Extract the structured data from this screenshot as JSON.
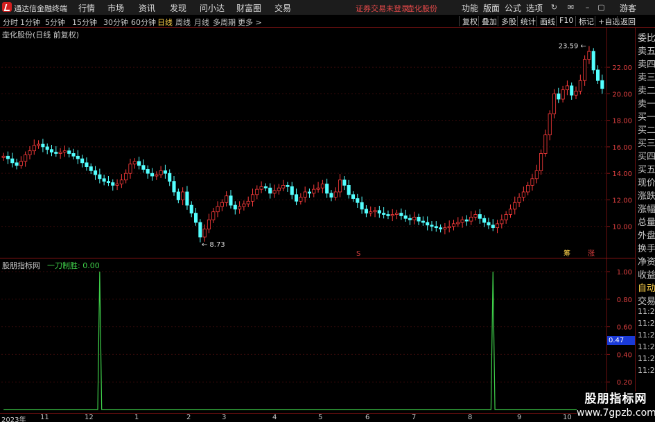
{
  "app": {
    "title": "通达信金融终端",
    "login_status": "证券交易未登录",
    "stock_name": "壶化股份"
  },
  "menu": [
    "行情",
    "市场",
    "资讯",
    "发现",
    "问小达",
    "财富圈",
    "交易"
  ],
  "right_menu": [
    "功能",
    "版面",
    "公式",
    "选项",
    "游客"
  ],
  "periods": [
    "分时",
    "1分钟",
    "5分钟",
    "15分钟",
    "30分钟",
    "60分钟",
    "日线",
    "周线",
    "月线",
    "多周期",
    "更多 >"
  ],
  "active_period": "日线",
  "toolbar_buttons": [
    "复权",
    "叠加",
    "多股",
    "统计",
    "画线",
    "F10",
    "标记",
    "+自选",
    "返回"
  ],
  "main_chart": {
    "title": "壶化股份(日线 前复权)",
    "y_ticks": [
      "22.00",
      "20.00",
      "18.00",
      "16.00",
      "14.00",
      "12.00",
      "10.00"
    ],
    "high_label": "23.59",
    "low_label": "8.73",
    "markers": [
      "S",
      "筹",
      "涨"
    ]
  },
  "indicator": {
    "title": "股朋指标网",
    "subtitle": "一刀制胜: 0.00",
    "y_ticks": [
      "1.00",
      "0.80",
      "0.60",
      "0.40",
      "0.20"
    ],
    "cursor_value": "0.47"
  },
  "right_panel": [
    "委比",
    "卖五",
    "卖四",
    "卖三",
    "卖二",
    "卖一",
    "买一",
    "买二",
    "买三",
    "买四",
    "买五",
    "现价",
    "涨跌",
    "涨幅",
    "总量",
    "外盘",
    "换手",
    "净资",
    "收益"
  ],
  "right_panel2": [
    "自动",
    "交易",
    "11:2",
    "11:2",
    "11:2",
    "11:2",
    "11:2",
    "11:2",
    "11:2",
    "11:2",
    "11:2",
    "11:2"
  ],
  "date_axis": [
    "2023年",
    "11",
    "12",
    "1",
    "2",
    "3",
    "4",
    "5",
    "6",
    "7",
    "8",
    "9",
    "10"
  ],
  "watermark": {
    "line1": "股朋指标网",
    "line2": "www.7gpzb.com"
  },
  "colors": {
    "up": "#ff3c3c",
    "down": "#54ffff",
    "indicator": "#3fd04a",
    "axis": "#6b1010"
  },
  "chart_data": {
    "type": "candlestick",
    "close": [
      15.3,
      15.1,
      14.8,
      14.6,
      14.9,
      15.4,
      15.7,
      16.1,
      16.2,
      16.0,
      15.8,
      15.6,
      15.5,
      15.6,
      15.7,
      15.5,
      15.3,
      15.1,
      14.8,
      14.5,
      14.2,
      13.9,
      13.6,
      13.4,
      13.3,
      13.1,
      13.2,
      13.5,
      14.0,
      14.7,
      14.9,
      14.6,
      14.3,
      14.0,
      13.8,
      13.9,
      14.2,
      14.0,
      13.4,
      12.6,
      12.0,
      12.6,
      11.6,
      11.0,
      10.3,
      9.2,
      9.8,
      10.5,
      11.1,
      11.5,
      11.8,
      12.3,
      11.6,
      11.3,
      11.5,
      11.7,
      11.9,
      12.4,
      12.8,
      13.0,
      12.9,
      12.5,
      12.7,
      12.9,
      13.1,
      13.0,
      12.4,
      11.9,
      12.2,
      12.6,
      12.5,
      12.8,
      12.9,
      13.2,
      12.5,
      12.2,
      12.6,
      13.5,
      13.1,
      12.4,
      12.1,
      11.8,
      11.3,
      11.0,
      11.1,
      11.2,
      11.0,
      10.9,
      10.8,
      10.9,
      11.0,
      10.8,
      10.6,
      10.5,
      10.7,
      10.4,
      10.3,
      10.1,
      10.0,
      9.9,
      9.8,
      9.9,
      10.0,
      10.2,
      10.3,
      10.5,
      10.4,
      10.7,
      10.9,
      10.6,
      10.3,
      10.1,
      9.9,
      10.2,
      10.5,
      10.9,
      11.3,
      11.8,
      12.2,
      12.6,
      13.1,
      13.6,
      14.2,
      15.5,
      16.9,
      18.5,
      20.0,
      19.6,
      20.3,
      20.6,
      19.9,
      20.2,
      21.0,
      22.6,
      23.2,
      21.8,
      21.0,
      20.4
    ],
    "indicator_signals": [
      0,
      0,
      0,
      0,
      0,
      0,
      0,
      0,
      0,
      0,
      0,
      0,
      0,
      0,
      0,
      0,
      0,
      0,
      0,
      0,
      0,
      0,
      0,
      0,
      0,
      0,
      0,
      0,
      0,
      0,
      0,
      0,
      0,
      0,
      0,
      0,
      0,
      0,
      0,
      0,
      0,
      0,
      0,
      0,
      0,
      0,
      0,
      0,
      0,
      0,
      0,
      0,
      0,
      0,
      0,
      0,
      0,
      0,
      0,
      0,
      0,
      0,
      0,
      0,
      0,
      0,
      0,
      0,
      0,
      0,
      0,
      0,
      0,
      0,
      0,
      0,
      0,
      0,
      0,
      0,
      0,
      0,
      0,
      0,
      0,
      0,
      0,
      0,
      0,
      0,
      0,
      0,
      0,
      0,
      0,
      0,
      0,
      0,
      0,
      0,
      0,
      0,
      0,
      0,
      0,
      0,
      0,
      0,
      0,
      0,
      0,
      0,
      0,
      0,
      0,
      0,
      0,
      0,
      0,
      0,
      0,
      0,
      0,
      0,
      0,
      0,
      0,
      0,
      0,
      0,
      0,
      0,
      0,
      0,
      0,
      0,
      0,
      0,
      0,
      0,
      0
    ],
    "signal_positions": [
      22,
      112
    ],
    "y_range": [
      8.0,
      24.2
    ],
    "indicator_range": [
      0,
      1.0
    ]
  }
}
